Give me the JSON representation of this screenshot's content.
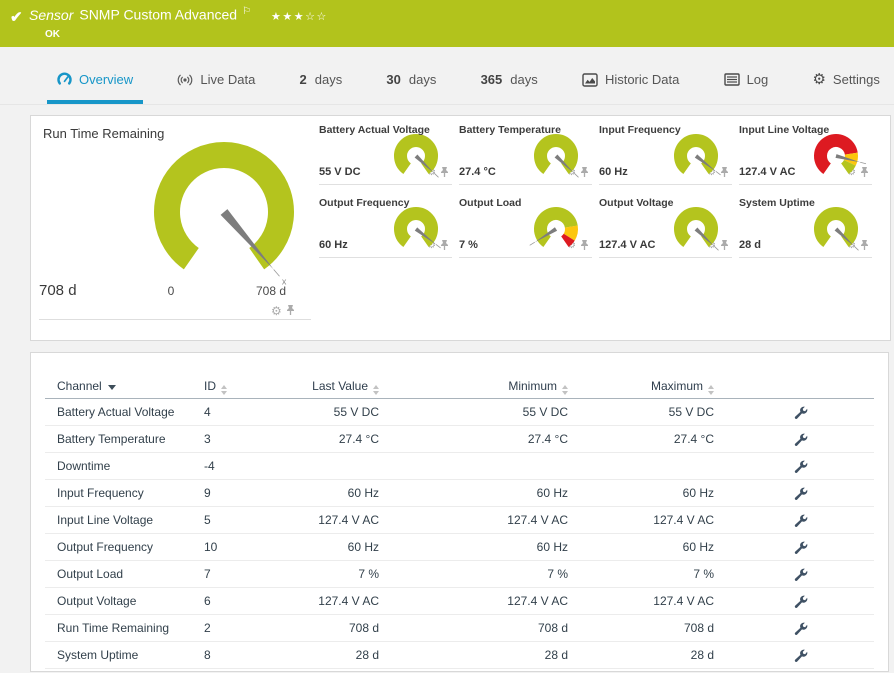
{
  "colors": {
    "brand_green": "#b2c31c",
    "green": "#b4c41e",
    "red": "#dd1a21",
    "yellow": "#fcc60e",
    "accent_blue": "#1796c8",
    "needle_gray": "#7d7d7d",
    "table_text": "#32404b"
  },
  "icons": {
    "check": "✔",
    "flag": "⚐",
    "gear": "⚙",
    "star_filled": "★",
    "star_empty": "☆"
  },
  "header": {
    "kind": "Sensor",
    "title": "SNMP Custom Advanced",
    "status": "OK",
    "stars_filled": 3,
    "stars_total": 5
  },
  "tabs": [
    {
      "id": "overview",
      "icon": "gauge-icon",
      "label": "Overview",
      "active": true
    },
    {
      "id": "live-data",
      "icon": "live-icon",
      "label": "Live Data",
      "active": false
    },
    {
      "id": "2-days",
      "num": "2",
      "label": "days",
      "active": false
    },
    {
      "id": "30-days",
      "num": "30",
      "label": "days",
      "active": false
    },
    {
      "id": "365-days",
      "num": "365",
      "label": "days",
      "active": false
    },
    {
      "id": "historic-data",
      "icon": "chart-icon",
      "label": "Historic Data",
      "active": false
    },
    {
      "id": "log",
      "icon": "log-icon",
      "label": "Log",
      "active": false
    },
    {
      "id": "settings",
      "icon": "gear-tab-icon",
      "label": "Settings",
      "active": false
    }
  ],
  "chart_data": {
    "type": "gauge-dashboard",
    "main_gauge": {
      "title": "Run Time Remaining",
      "value": "708 d",
      "scale_min": "0",
      "scale_max": "708 d",
      "needle_fraction": 0.98,
      "segments": [
        {
          "to": 1,
          "color": "green"
        }
      ]
    },
    "small_gauges": [
      {
        "title": "Battery Actual Voltage",
        "value": "55 V DC",
        "needle_fraction": 0.96,
        "segments": [
          {
            "to": 1,
            "color": "green"
          }
        ]
      },
      {
        "title": "Battery Temperature",
        "value": "27.4 °C",
        "needle_fraction": 0.96,
        "segments": [
          {
            "to": 1,
            "color": "green"
          }
        ]
      },
      {
        "title": "Input Frequency",
        "value": "60 Hz",
        "needle_fraction": 0.94,
        "segments": [
          {
            "to": 1,
            "color": "green"
          }
        ]
      },
      {
        "title": "Input Line Voltage",
        "value": "127.4 V AC",
        "needle_fraction": 0.86,
        "segments": [
          {
            "to": 0.78,
            "color": "red"
          },
          {
            "to": 0.9,
            "color": "yellow"
          },
          {
            "to": 1,
            "color": "green"
          }
        ]
      },
      {
        "title": "Output Frequency",
        "value": "60 Hz",
        "needle_fraction": 0.94,
        "segments": [
          {
            "to": 1,
            "color": "green"
          }
        ]
      },
      {
        "title": "Output Load",
        "value": "7 %",
        "needle_fraction": 0.08,
        "segments": [
          {
            "to": 0.78,
            "color": "green"
          },
          {
            "to": 0.92,
            "color": "yellow"
          },
          {
            "to": 1,
            "color": "red"
          }
        ]
      },
      {
        "title": "Output Voltage",
        "value": "127.4 V AC",
        "needle_fraction": 0.96,
        "segments": [
          {
            "to": 1,
            "color": "green"
          }
        ]
      },
      {
        "title": "System Uptime",
        "value": "28 d",
        "needle_fraction": 0.96,
        "segments": [
          {
            "to": 1,
            "color": "green"
          }
        ]
      }
    ],
    "gauge_cell_icons": [
      "gear-icon",
      "pin-icon"
    ]
  },
  "table": {
    "columns": [
      {
        "label": "Channel",
        "sort": "active-desc",
        "align": "left"
      },
      {
        "label": "ID",
        "sort": "both",
        "align": "left"
      },
      {
        "label": "Last Value",
        "sort": "both",
        "align": "right"
      },
      {
        "label": "Minimum",
        "sort": "both",
        "align": "right"
      },
      {
        "label": "Maximum",
        "sort": "both",
        "align": "right"
      }
    ],
    "row_action_icon": "wrench-icon",
    "rows": [
      {
        "channel": "Battery Actual Voltage",
        "id": "4",
        "last": "55 V DC",
        "min": "55 V DC",
        "max": "55 V DC"
      },
      {
        "channel": "Battery Temperature",
        "id": "3",
        "last": "27.4 °C",
        "min": "27.4 °C",
        "max": "27.4 °C"
      },
      {
        "channel": "Downtime",
        "id": "-4",
        "last": "",
        "min": "",
        "max": ""
      },
      {
        "channel": "Input Frequency",
        "id": "9",
        "last": "60 Hz",
        "min": "60 Hz",
        "max": "60 Hz"
      },
      {
        "channel": "Input Line Voltage",
        "id": "5",
        "last": "127.4 V AC",
        "min": "127.4 V AC",
        "max": "127.4 V AC"
      },
      {
        "channel": "Output Frequency",
        "id": "10",
        "last": "60 Hz",
        "min": "60 Hz",
        "max": "60 Hz"
      },
      {
        "channel": "Output Load",
        "id": "7",
        "last": "7 %",
        "min": "7 %",
        "max": "7 %"
      },
      {
        "channel": "Output Voltage",
        "id": "6",
        "last": "127.4 V AC",
        "min": "127.4 V AC",
        "max": "127.4 V AC"
      },
      {
        "channel": "Run Time Remaining",
        "id": "2",
        "last": "708 d",
        "min": "708 d",
        "max": "708 d"
      },
      {
        "channel": "System Uptime",
        "id": "8",
        "last": "28 d",
        "min": "28 d",
        "max": "28 d"
      }
    ]
  }
}
